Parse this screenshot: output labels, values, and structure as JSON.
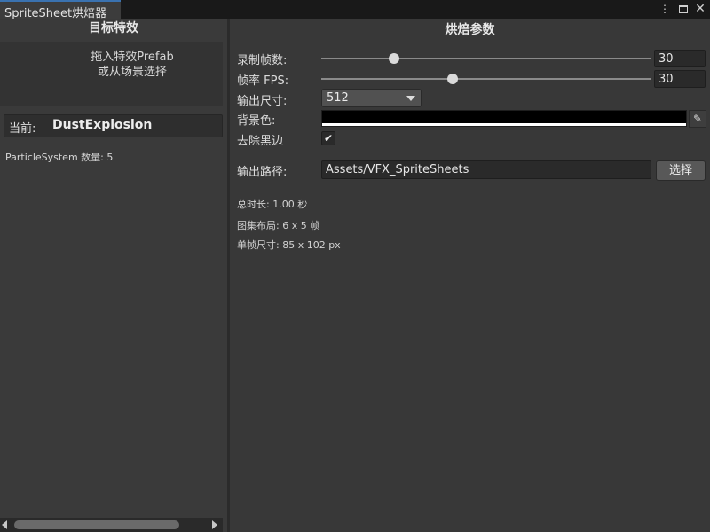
{
  "window": {
    "tab_title": "SpriteSheet烘焙器",
    "menu_icon": "more-vertical-icon",
    "maximize_icon": "maximize-icon",
    "close_icon": "close-icon"
  },
  "left_panel": {
    "header": "目标特效",
    "drop_zone": {
      "line1": "拖入特效Prefab",
      "line2": "或从场景选择"
    },
    "current": {
      "label": "当前:",
      "value": "DustExplosion"
    },
    "particle_count": "ParticleSystem 数量: 5"
  },
  "right_panel": {
    "header": "烘焙参数",
    "record_fps": {
      "label": "录制帧数:",
      "value": "30",
      "slider_fraction": 0.22
    },
    "frame_rate": {
      "label": "帧率 FPS:",
      "value": "30",
      "slider_fraction": 0.4
    },
    "output_size": {
      "label": "输出尺寸:",
      "value": "512"
    },
    "background_color": {
      "label": "背景色:",
      "color": "#000000",
      "eyedropper_icon": "eyedropper-icon"
    },
    "trim_black_edges": {
      "label": "去除黑边",
      "checked": true,
      "check_glyph": "✔"
    },
    "output_path": {
      "label": "输出路径:",
      "value": "Assets/VFX_SpriteSheets",
      "button": "选择"
    },
    "info": {
      "duration": "总时长: 1.00 秒",
      "atlas_layout": "图集布局: 6 x 5 帧",
      "frame_size": "单帧尺寸: 85 x 102 px"
    }
  },
  "colors": {
    "panel_bg": "#383838",
    "field_bg": "#2a2a2a",
    "tab_accent": "#3a72b0"
  }
}
